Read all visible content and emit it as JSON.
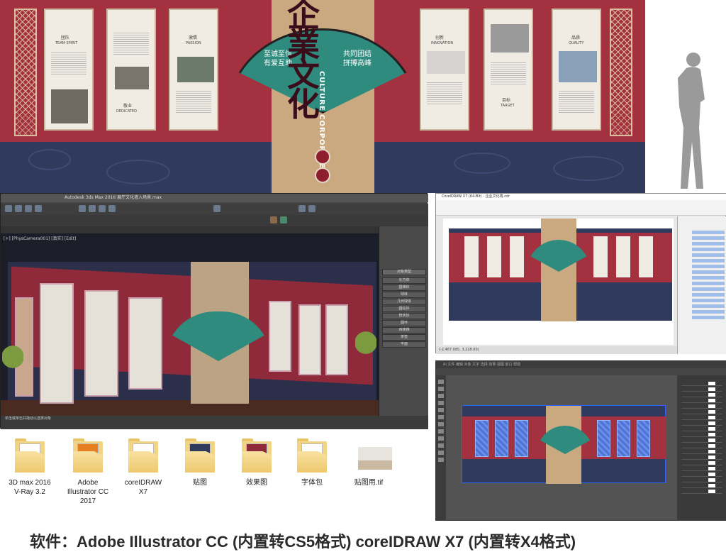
{
  "design": {
    "left_panels": [
      {
        "cn": "团队",
        "en": "TEAM SPIRIT"
      },
      {
        "cn": "激情",
        "en": "PASSION"
      },
      {
        "cn": "敬业",
        "en": "DEDICATED"
      }
    ],
    "right_panels": [
      {
        "cn": "创新",
        "en": "INNOVATION"
      },
      {
        "cn": "品质",
        "en": "QUALITY"
      },
      {
        "cn": "目标",
        "en": "TARGET"
      }
    ],
    "fan_left_line1": "至诚至信",
    "fan_left_line2": "有爱互助",
    "fan_right_line1": "共同团结",
    "fan_right_line2": "拼搏高峰",
    "calligraphy": "企業文化",
    "vertical_en": "CULTURE CORPORATE"
  },
  "max": {
    "title": "Autodesk 3ds Max 2016   展厅文化墙入场景.max",
    "viewport_label": "[+] [PhysCamera001] [真实] [Edit]",
    "status": "单击或单击并拖动以选择对象",
    "cmd_header": "对象类型",
    "cmd_items": [
      "长方体",
      "圆锥体",
      "球体",
      "几何球体",
      "圆柱体",
      "管状体",
      "圆环",
      "四棱锥",
      "茶壶",
      "平面"
    ]
  },
  "corel": {
    "title": "CorelDRAW X7 (64-Bit) - 企业文化墙.cdr",
    "status": "(-2,467.085, 3,228.00)"
  },
  "ai": {
    "menu": "Ai  文件  编辑  对象  文字  选择  效果  视图  窗口  帮助"
  },
  "folders": [
    {
      "name": "3D max 2016 V-Ray 3.2",
      "icon": "folder-icon"
    },
    {
      "name": "Adobe Illustrator CC 2017",
      "icon": "folder-icon"
    },
    {
      "name": "coreIDRAW X7",
      "icon": "folder-icon"
    },
    {
      "name": "贴图",
      "icon": "folder-icon"
    },
    {
      "name": "效果图",
      "icon": "folder-icon"
    },
    {
      "name": "字体包",
      "icon": "folder-icon"
    },
    {
      "name": "贴图用.tif",
      "icon": "image-file-icon"
    }
  ],
  "footer": "软件：Adobe Illustrator CC (内置转CS5格式)  coreIDRAW X7 (内置转X4格式)"
}
